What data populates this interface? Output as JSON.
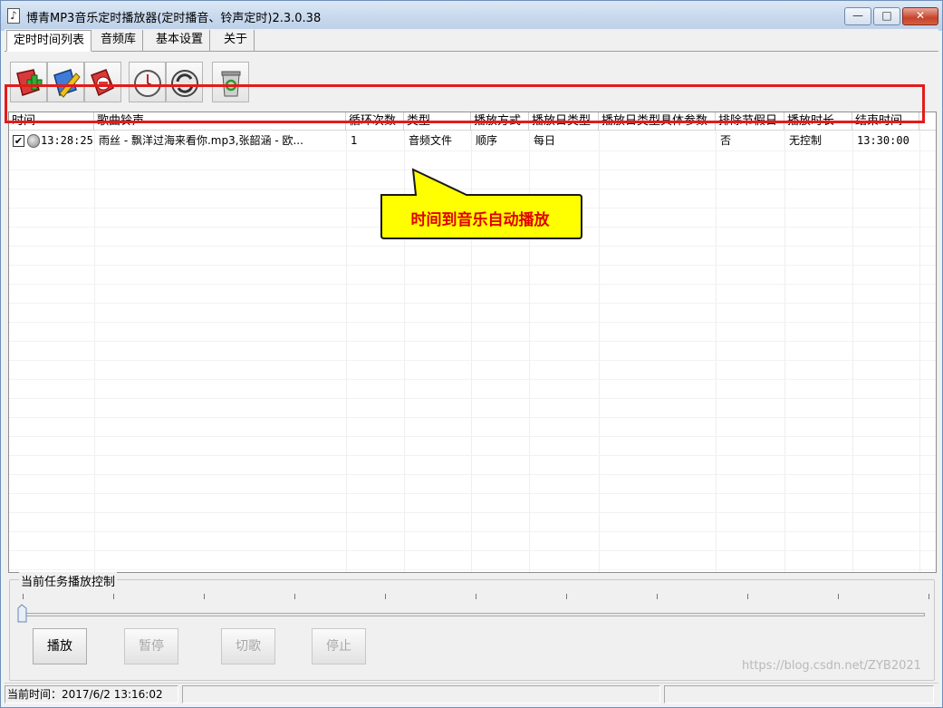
{
  "window": {
    "title": "博青MP3音乐定时播放器(定时播音、铃声定时)2.3.0.38",
    "min_glyph": "—",
    "max_glyph": "□",
    "close_glyph": "✕"
  },
  "tabs": [
    {
      "label": "定时时间列表",
      "active": true
    },
    {
      "label": "音频库",
      "active": false
    },
    {
      "label": "基本设置",
      "active": false
    },
    {
      "label": "关于",
      "active": false
    }
  ],
  "toolbar": {
    "icons": [
      "add-task-icon",
      "edit-task-icon",
      "delete-task-icon",
      "clock-icon",
      "refresh-icon",
      "recycle-bin-icon"
    ]
  },
  "list": {
    "columns": [
      "时间",
      "歌曲铃声",
      "循环次数",
      "类型",
      "播放方式",
      "播放日类型",
      "播放日类型具体参数",
      "排除节假日",
      "播放时长",
      "结束时间"
    ],
    "rows": [
      {
        "checked": true,
        "time": "13:28:25",
        "song": "雨丝 - 飘洋过海来看你.mp3,张韶涵 - 欧...",
        "loops": "1",
        "type": "音频文件",
        "mode": "顺序",
        "day_type": "每日",
        "day_params": "",
        "exclude_holidays": "否",
        "duration": "无控制",
        "end_time": "13:30:00"
      }
    ]
  },
  "callout": {
    "text": "时间到音乐自动播放",
    "text_color": "#e00000",
    "fill": "#ffff00",
    "border": "#1a1a1a"
  },
  "highlight_color": "#e31b1b",
  "playback": {
    "group_label": "当前任务播放控制",
    "position": 0,
    "buttons": [
      {
        "label": "播放",
        "enabled": true
      },
      {
        "label": "暂停",
        "enabled": false
      },
      {
        "label": "切歌",
        "enabled": false
      },
      {
        "label": "停止",
        "enabled": false
      }
    ]
  },
  "status": {
    "current_time": "当前时间：2017/6/2 13:16:02",
    "watermark": "https://blog.csdn.net/ZYB2021"
  }
}
